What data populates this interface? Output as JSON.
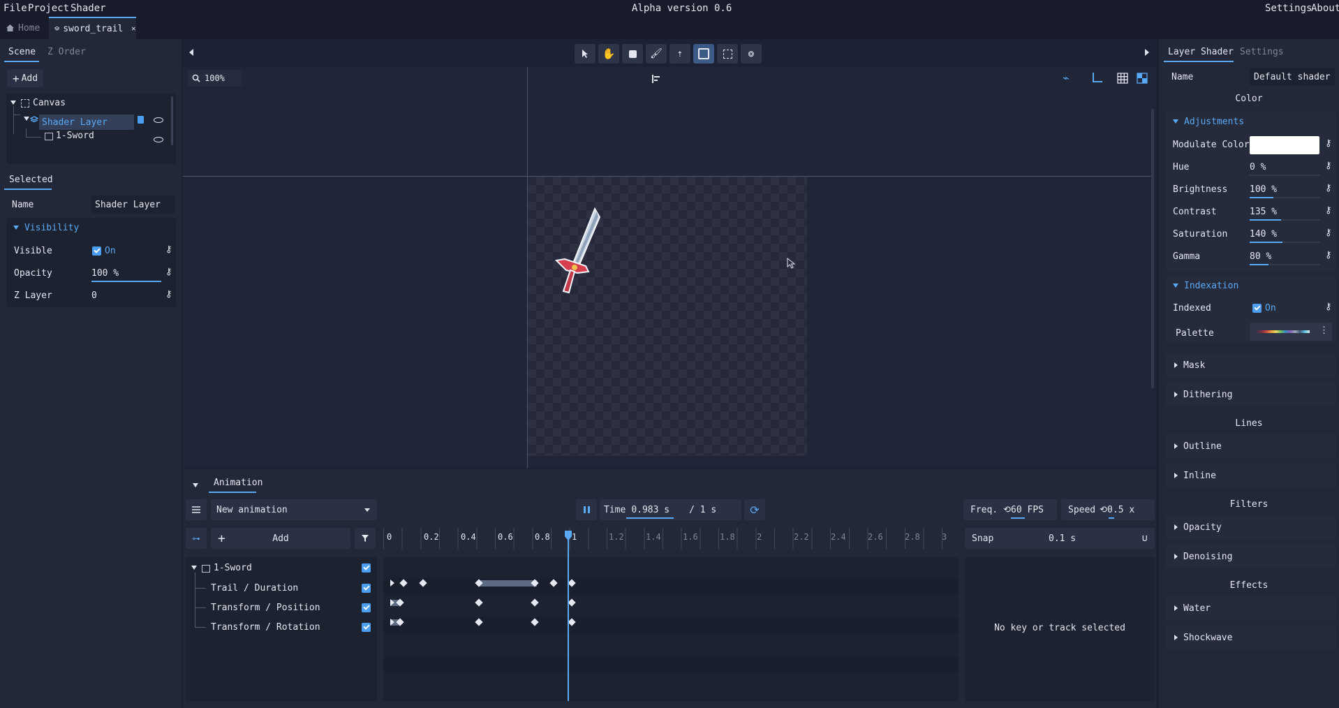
{
  "menu": {
    "file": "File",
    "project": "Project",
    "shader": "Shader",
    "title": "Alpha version 0.6",
    "settings": "Settings",
    "about": "About"
  },
  "tabs": {
    "home": "Home",
    "project": "sword_trail"
  },
  "left": {
    "tab_scene": "Scene",
    "tab_zorder": "Z Order",
    "add": "Add",
    "tree": {
      "canvas": "Canvas",
      "shader_layer": "Shader Layer",
      "sword": "1-Sword"
    },
    "selected_header": "Selected",
    "name_label": "Name",
    "name_value": "Shader Layer",
    "visibility": "Visibility",
    "visible_label": "Visible",
    "visible_value": "On",
    "opacity_label": "Opacity",
    "opacity_value": "100 %",
    "zlayer_label": "Z Layer",
    "zlayer_value": "0"
  },
  "viewport": {
    "zoom": "100%"
  },
  "anim": {
    "tab": "Animation",
    "animation_name": "New animation",
    "time_label": "Time",
    "time_value": "0.983 s",
    "duration": "/ 1 s",
    "freq_label": "Freq.",
    "freq_value": "60 FPS",
    "speed_label": "Speed",
    "speed_value": "0.5 x",
    "add": "Add",
    "snap_label": "Snap",
    "snap_value": "0.1 s",
    "ruler": [
      "0",
      "0.2",
      "0.4",
      "0.6",
      "0.8",
      "1",
      "1.2",
      "1.4",
      "1.6",
      "1.8",
      "2",
      "2.2",
      "2.4",
      "2.6",
      "2.8",
      "3"
    ],
    "group": "1-Sword",
    "tracks": [
      "Trail / Duration",
      "Transform / Position",
      "Transform / Rotation"
    ],
    "empty": "No key or track selected"
  },
  "right": {
    "tab_shader": "Layer Shader",
    "tab_settings": "Settings",
    "name_label": "Name",
    "name_value": "Default shader",
    "color_header": "Color",
    "adjustments": "Adjustments",
    "modulate_label": "Modulate Color",
    "hue_label": "Hue",
    "hue_value": "0 %",
    "brightness_label": "Brightness",
    "brightness_value": "100 %",
    "contrast_label": "Contrast",
    "contrast_value": "135 %",
    "saturation_label": "Saturation",
    "saturation_value": "140 %",
    "gamma_label": "Gamma",
    "gamma_value": "80 %",
    "indexation": "Indexation",
    "indexed_label": "Indexed",
    "indexed_value": "On",
    "palette_label": "Palette",
    "mask": "Mask",
    "dithering": "Dithering",
    "lines_header": "Lines",
    "outline": "Outline",
    "inline": "Inline",
    "filters_header": "Filters",
    "opacity": "Opacity",
    "denoising": "Denoising",
    "effects_header": "Effects",
    "water": "Water",
    "shockwave": "Shockwave"
  },
  "colors": {
    "accent": "#5aa9f5",
    "bg": "#1c2133",
    "panel": "#232838"
  }
}
